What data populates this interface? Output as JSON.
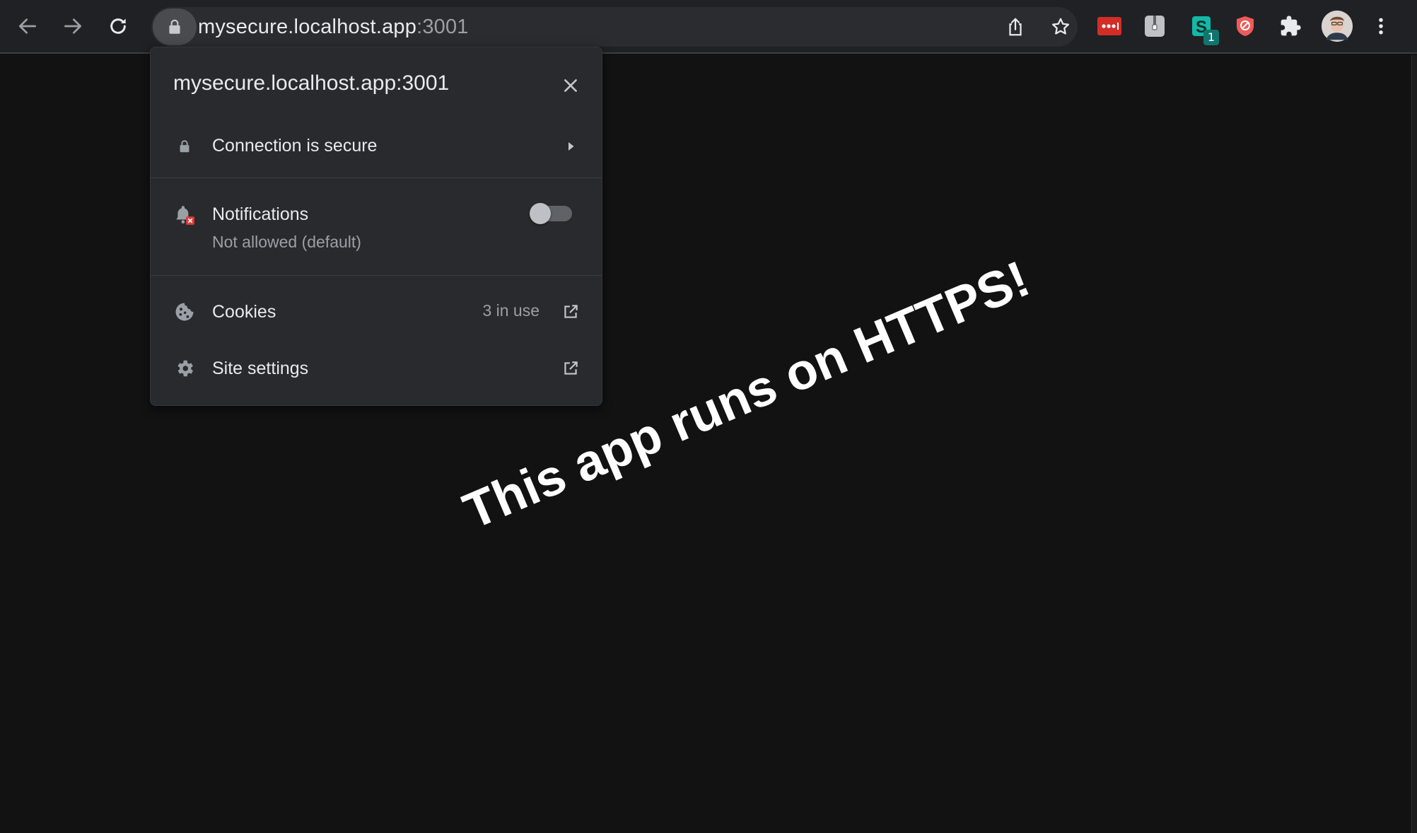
{
  "browser": {
    "url_host": "mysecure.localhost.app",
    "url_port": ":3001",
    "extension_badge": "1"
  },
  "site_info": {
    "title": "mysecure.localhost.app:3001",
    "connection": {
      "label": "Connection is secure"
    },
    "notifications": {
      "label": "Notifications",
      "status": "Not allowed (default)",
      "enabled": false
    },
    "cookies": {
      "label": "Cookies",
      "count": "3 in use"
    },
    "site_settings": {
      "label": "Site settings"
    }
  },
  "page": {
    "heading": "This app runs on HTTPS!"
  },
  "colors": {
    "toolbar": "#202124",
    "popup": "#292a2d",
    "page": "#121212",
    "text": "#e8eaed",
    "muted": "#9aa0a6",
    "blocked_badge": "#e53935"
  },
  "icons": [
    "back-arrow-icon",
    "forward-arrow-icon",
    "reload-icon",
    "lock-icon",
    "share-icon",
    "bookmark-star-icon",
    "lastpass-extension-icon",
    "zip-extension-icon",
    "s-extension-icon",
    "shield-extension-icon",
    "puzzle-extensions-icon",
    "avatar",
    "kebab-menu-icon",
    "close-icon",
    "chevron-right-icon",
    "notifications-blocked-icon",
    "cookie-icon",
    "gear-icon",
    "open-external-icon"
  ]
}
